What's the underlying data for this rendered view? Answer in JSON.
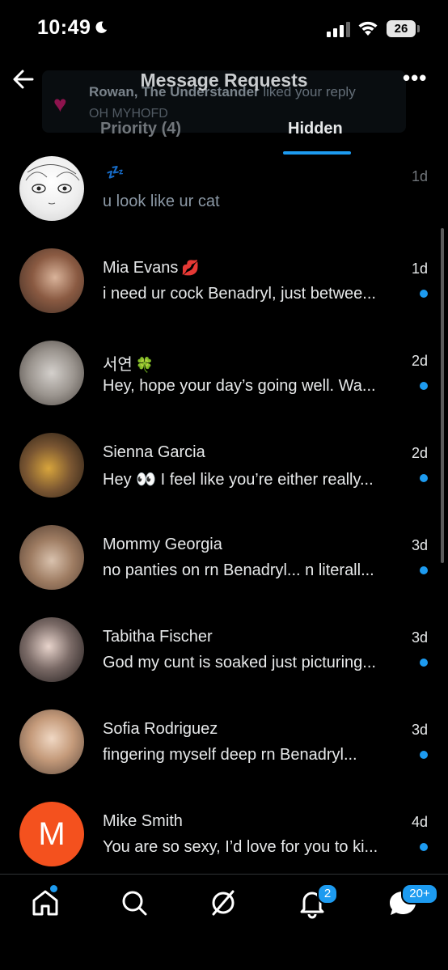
{
  "status_bar": {
    "time": "10:49",
    "battery": "26"
  },
  "toast": {
    "name": "Rowan, The Understander",
    "action": " liked your reply",
    "snippet": "OH MYHOFD"
  },
  "header": {
    "title": "Message Requests"
  },
  "tabs": [
    {
      "label": "Priority (4)",
      "active": false
    },
    {
      "label": "Hidden",
      "active": true
    }
  ],
  "messages": [
    {
      "name": "",
      "name_emoji": "💤",
      "preview": "u look like ur cat",
      "date": "1d",
      "unread": false
    },
    {
      "name": "Mia Evans",
      "name_emoji": "💋",
      "preview": "i need ur cock Benadryl, just betwee...",
      "date": "1d",
      "unread": true
    },
    {
      "name": "서연",
      "name_emoji": "🍀",
      "preview": "Hey, hope your day’s going well. Wa...",
      "date": "2d",
      "unread": true
    },
    {
      "name": "Sienna Garcia",
      "name_emoji": "",
      "preview": "Hey 👀 I feel like you’re either really...",
      "date": "2d",
      "unread": true
    },
    {
      "name": "Mommy Georgia",
      "name_emoji": "",
      "preview": "no panties on rn Benadryl... n  literall...",
      "date": "3d",
      "unread": true
    },
    {
      "name": "Tabitha Fischer",
      "name_emoji": "",
      "preview": "God my cunt is soaked just picturing...",
      "date": "3d",
      "unread": true
    },
    {
      "name": "Sofia Rodriguez",
      "name_emoji": "",
      "preview": "fingering myself deep rn Benadryl...",
      "date": "3d",
      "unread": true
    },
    {
      "name": "Mike Smith",
      "name_emoji": "",
      "avatar_initial": "M",
      "preview": "You are so sexy, I’d love for you to ki...",
      "date": "4d",
      "unread": true
    }
  ],
  "bottom_nav": {
    "items": [
      "home-icon",
      "search-icon",
      "grok-icon",
      "bell-icon",
      "messages-icon"
    ],
    "notifications_badge": "2",
    "messages_badge": "20+"
  },
  "colors": {
    "accent": "#1d9bf0",
    "background": "#000000",
    "avatar_m": "#f4511e"
  }
}
